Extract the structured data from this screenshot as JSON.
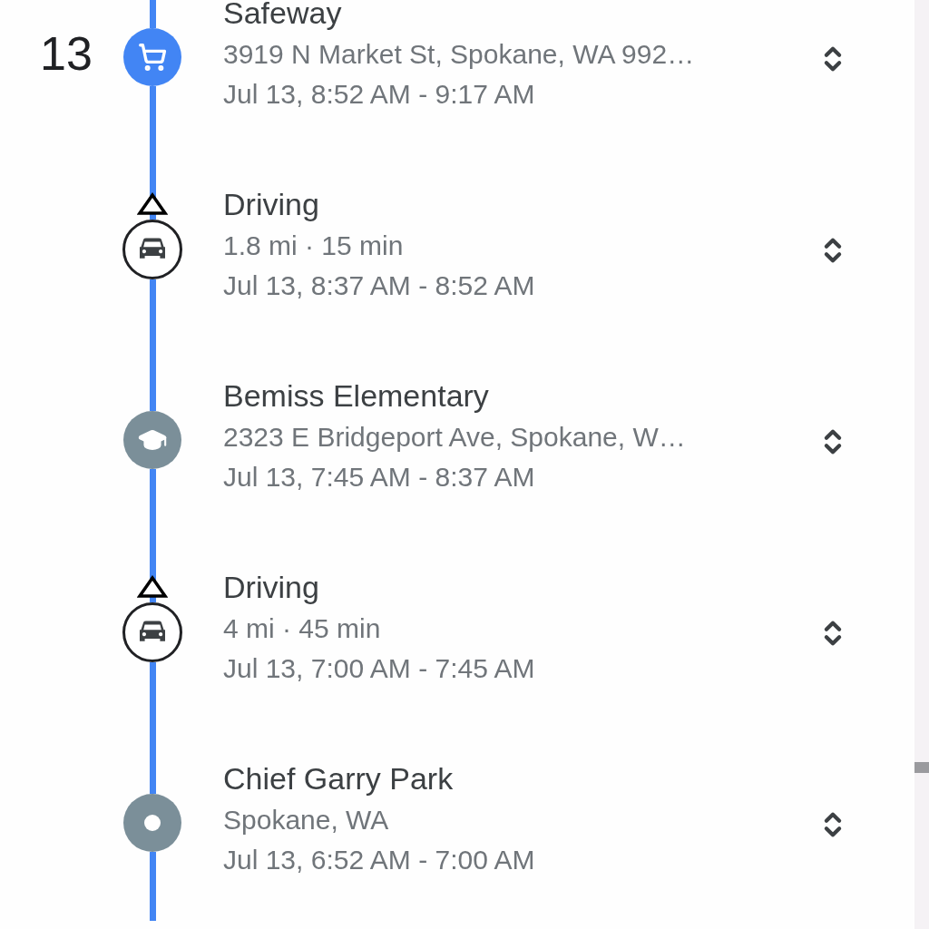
{
  "items": [
    {
      "kind": "store",
      "color": "#4285f4",
      "index": "13",
      "title": "Safeway",
      "subtitle": "3919 N Market St, Spokane, WA 992…",
      "time": "Jul 13, 8:52 AM - 9:17 AM"
    },
    {
      "kind": "drive",
      "title": "Driving",
      "subtitle": "1.8 mi · 15 min",
      "time": "Jul 13, 8:37 AM - 8:52 AM"
    },
    {
      "kind": "school",
      "color": "#7b8f99",
      "title": "Bemiss Elementary",
      "subtitle": "2323 E Bridgeport Ave, Spokane, W…",
      "time": "Jul 13, 7:45 AM - 8:37 AM"
    },
    {
      "kind": "drive",
      "title": "Driving",
      "subtitle": "4 mi · 45 min",
      "time": "Jul 13, 7:00 AM - 7:45 AM"
    },
    {
      "kind": "place",
      "color": "#7b8f99",
      "title": "Chief Garry Park",
      "subtitle": "Spokane, WA",
      "time": "Jul 13, 6:52 AM - 7:00 AM"
    }
  ]
}
